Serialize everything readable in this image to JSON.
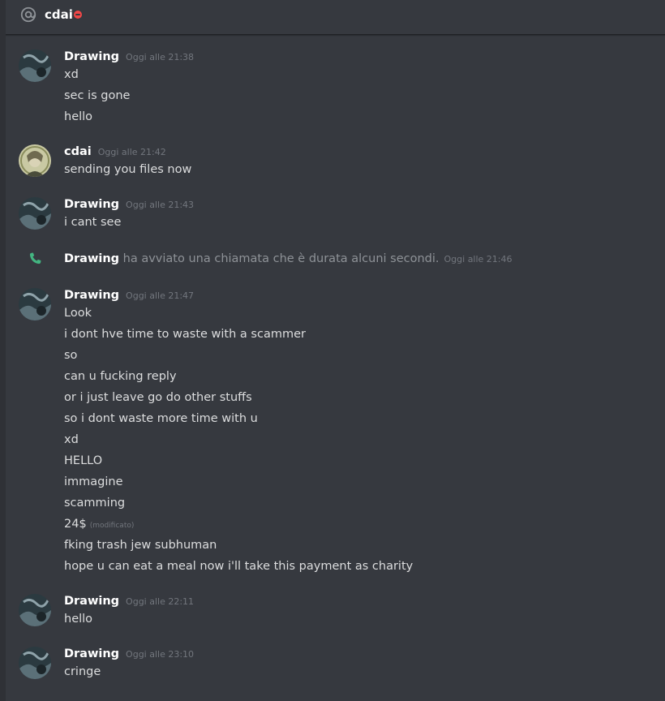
{
  "header": {
    "channel_name": "cdai",
    "at_icon": "at-icon",
    "status_icon": "dnd-status-icon"
  },
  "colors": {
    "background": "#36393f",
    "header_border": "#202225",
    "author": "#ffffff",
    "message_text": "#dcddde",
    "timestamp": "#72767d",
    "dnd_red": "#f04747",
    "call_green": "#43b581"
  },
  "messages": [
    {
      "author": "Drawing",
      "avatar": "dark-avatar",
      "timestamp": "Oggi alle 21:38",
      "lines": [
        "xd",
        "sec is gone",
        "hello"
      ]
    },
    {
      "author": "cdai",
      "avatar": "money-avatar",
      "timestamp": "Oggi alle 21:42",
      "lines": [
        "sending you files now"
      ]
    },
    {
      "author": "Drawing",
      "avatar": "dark-avatar",
      "timestamp": "Oggi alle 21:43",
      "lines": [
        "i cant see"
      ]
    },
    {
      "author": "Drawing",
      "avatar": "dark-avatar",
      "timestamp": "Oggi alle 21:47",
      "lines": [
        "Look",
        "i dont hve time to waste with a scammer",
        "so",
        "can u fucking reply",
        "or i just leave go do other stuffs",
        "so i dont waste more time with u",
        "xd",
        "HELLO",
        "immagine",
        "scamming",
        "24$",
        "fking trash jew subhuman",
        "hope u can eat a meal now i'll take this payment as charity"
      ],
      "edited_label": "(modificato)"
    },
    {
      "author": "Drawing",
      "avatar": "dark-avatar",
      "timestamp": "Oggi alle 22:11",
      "lines": [
        "hello"
      ]
    },
    {
      "author": "Drawing",
      "avatar": "dark-avatar",
      "timestamp": "Oggi alle 23:10",
      "lines": [
        "cringe"
      ]
    }
  ],
  "system_message": {
    "icon": "phone-icon",
    "author": "Drawing",
    "text": "ha avviato una chiamata che è durata alcuni secondi.",
    "timestamp": "Oggi alle 21:46"
  }
}
